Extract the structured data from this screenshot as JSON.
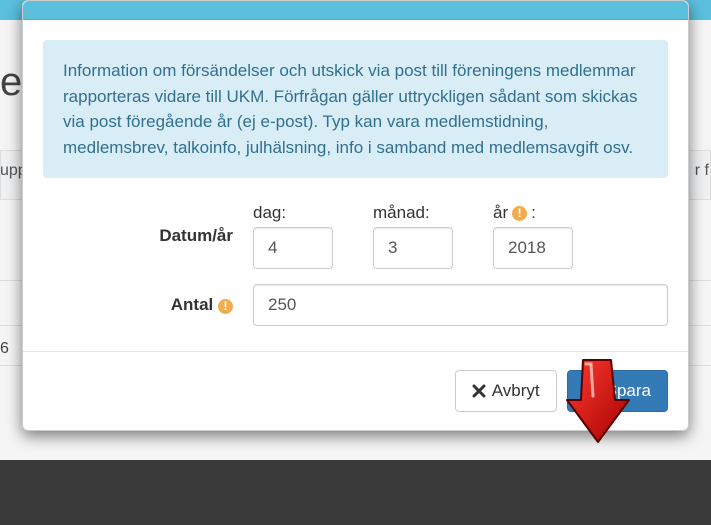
{
  "background": {
    "left_letter": "e",
    "tab_left_fragment": "upp",
    "tab_right_fragment": "r f",
    "row_number": "6"
  },
  "info_text": "Information om försändelser och utskick via post till föreningens medlemmar rapporteras vidare till UKM. Förfrågan gäller uttryckligen sådant som skickas via post föregående år (ej e-post). Typ kan vara medlemstidning, medlemsbrev, talkoinfo, julhälsning, info i samband med medlemsavgift osv.",
  "form": {
    "date_label": "Datum/år",
    "day_label": "dag:",
    "month_label": "månad:",
    "year_label": "år",
    "year_colon": ":",
    "day_value": "4",
    "month_value": "3",
    "year_value": "2018",
    "count_label": "Antal",
    "count_value": "250"
  },
  "buttons": {
    "cancel": "Avbryt",
    "save": "Spara"
  },
  "icons": {
    "warn_glyph": "!"
  }
}
